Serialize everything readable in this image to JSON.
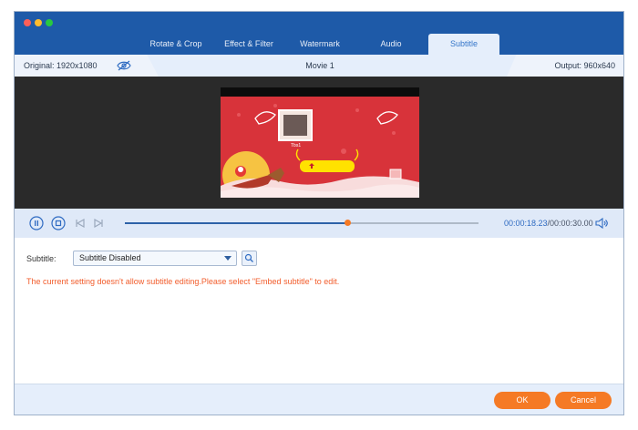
{
  "window": {
    "traffic_lights": [
      "#fe5f57",
      "#febc2e",
      "#28c840"
    ]
  },
  "tabs": [
    {
      "label": "Rotate & Crop",
      "active": false
    },
    {
      "label": "Effect & Filter",
      "active": false
    },
    {
      "label": "Watermark",
      "active": false
    },
    {
      "label": "Audio",
      "active": false
    },
    {
      "label": "Subtitle",
      "active": true
    }
  ],
  "infobar": {
    "original": "Original: 1920x1080",
    "title": "Movie 1",
    "output": "Output: 960x640",
    "eye_icon": "eye-slash-icon"
  },
  "video": {
    "stamp_label": "Tbs1"
  },
  "playback": {
    "current_time": "00:00:18.23",
    "total_time": "/00:00:30.00",
    "progress": 0.63,
    "icons": [
      "play-icon",
      "stop-icon",
      "skip-back-icon",
      "skip-forward-icon",
      "volume-icon"
    ]
  },
  "subtitle": {
    "label": "Subtitle:",
    "selected": "Subtitle Disabled",
    "warning": "The current setting doesn't allow subtitle editing.Please select \"Embed subtitle\" to edit."
  },
  "footer": {
    "ok_label": "OK",
    "cancel_label": "Cancel"
  },
  "colors": {
    "accent_blue": "#1e5aa8",
    "orange": "#f57a25",
    "warning_text": "#f25d2c"
  }
}
